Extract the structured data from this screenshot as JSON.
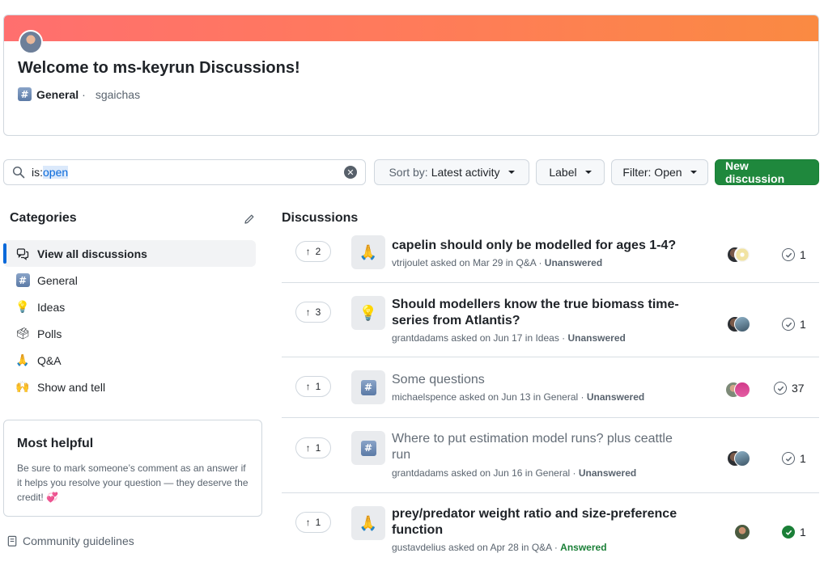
{
  "welcome": {
    "title": "Welcome to ms-keyrun Discussions!",
    "category": "General",
    "author": "sgaichas"
  },
  "search": {
    "prefix": "is:",
    "value": "open"
  },
  "toolbar": {
    "sort_prefix": "Sort by:",
    "sort_value": "Latest activity",
    "label": "Label",
    "filter": "Filter: Open",
    "new": "New discussion"
  },
  "sidebar": {
    "heading": "Categories",
    "items": [
      {
        "label": "View all discussions",
        "icon": "discussions-icon",
        "active": true
      },
      {
        "label": "General",
        "icon": "hash-icon"
      },
      {
        "label": "Ideas",
        "icon": "lightbulb-icon"
      },
      {
        "label": "Polls",
        "icon": "ballot-box-icon"
      },
      {
        "label": "Q&A",
        "icon": "pray-icon"
      },
      {
        "label": "Show and tell",
        "icon": "raised-hands-icon"
      }
    ],
    "helpful": {
      "title": "Most helpful",
      "text": "Be sure to mark someone’s comment as an answer if it helps you resolve your question — they deserve the credit! 💞"
    },
    "guidelines": "Community guidelines"
  },
  "main": {
    "heading": "Discussions",
    "discussions": [
      {
        "votes": "2",
        "icon": "pray-icon",
        "title": "capelin should only be modelled for ages 1-4?",
        "author": "vtrijoulet",
        "date": "Mar 29",
        "category": "Q&A",
        "status": "Unanswered",
        "comments": "1"
      },
      {
        "votes": "3",
        "icon": "lightbulb-icon",
        "title": "Should modellers know the true biomass time-series from Atlantis?",
        "author": "grantdadams",
        "date": "Jun 17",
        "category": "Ideas",
        "status": "Unanswered",
        "comments": "1"
      },
      {
        "votes": "1",
        "icon": "hash-icon",
        "title": "Some questions",
        "author": "michaelspence",
        "date": "Jun 13",
        "category": "General",
        "status": "Unanswered",
        "comments": "37"
      },
      {
        "votes": "1",
        "icon": "hash-icon",
        "title": "Where to put estimation model runs? plus ceattle run",
        "author": "grantdadams",
        "date": "Jun 16",
        "category": "General",
        "status": "Unanswered",
        "comments": "1"
      },
      {
        "votes": "1",
        "icon": "pray-icon",
        "title": "prey/predator weight ratio and size-preference function",
        "author": "gustavdelius",
        "date": "Apr 28",
        "category": "Q&A",
        "status": "Answered",
        "comments": "1"
      }
    ]
  },
  "colors": {
    "accent": "#0969da",
    "primary_button": "#1f883d",
    "answered": "#1a7f37"
  }
}
